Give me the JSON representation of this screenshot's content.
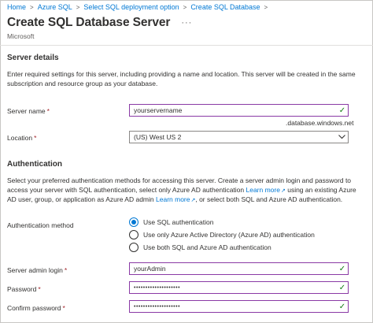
{
  "breadcrumb": {
    "items": [
      "Home",
      "Azure SQL",
      "Select SQL deployment option",
      "Create SQL Database"
    ]
  },
  "page": {
    "title": "Create SQL Database Server",
    "more": "···",
    "subtitle": "Microsoft"
  },
  "server_details": {
    "heading": "Server details",
    "description": "Enter required settings for this server, including providing a name and location. This server will be created in the same subscription and resource group as your database.",
    "server_name_label": "Server name",
    "server_name_value": "yourservername",
    "server_suffix": ".database.windows.net",
    "location_label": "Location",
    "location_value": "(US) West US 2"
  },
  "authentication": {
    "heading": "Authentication",
    "desc_part1": "Select your preferred authentication methods for accessing this server. Create a server admin login and password to access your server with SQL authentication, select only Azure AD authentication",
    "learn_more_1": "Learn more",
    "desc_part2": "using an existing Azure AD user, group, or application as Azure AD admin",
    "learn_more_2": "Learn more",
    "desc_part3": ", or select both SQL and Azure AD authentication.",
    "method_label": "Authentication method",
    "options": [
      {
        "label": "Use SQL authentication",
        "selected": true
      },
      {
        "label": "Use only Azure Active Directory (Azure AD) authentication",
        "selected": false
      },
      {
        "label": "Use both SQL and Azure AD authentication",
        "selected": false
      }
    ],
    "admin_login_label": "Server admin login",
    "admin_login_value": "yourAdmin",
    "password_label": "Password",
    "password_value": "••••••••••••••••••••",
    "confirm_label": "Confirm password",
    "confirm_value": "••••••••••••••••••••"
  },
  "required_marker": "*",
  "colors": {
    "accent": "#0078d4",
    "focus_border": "#8a3aa5",
    "valid": "#107c10",
    "required": "#a4262c"
  }
}
